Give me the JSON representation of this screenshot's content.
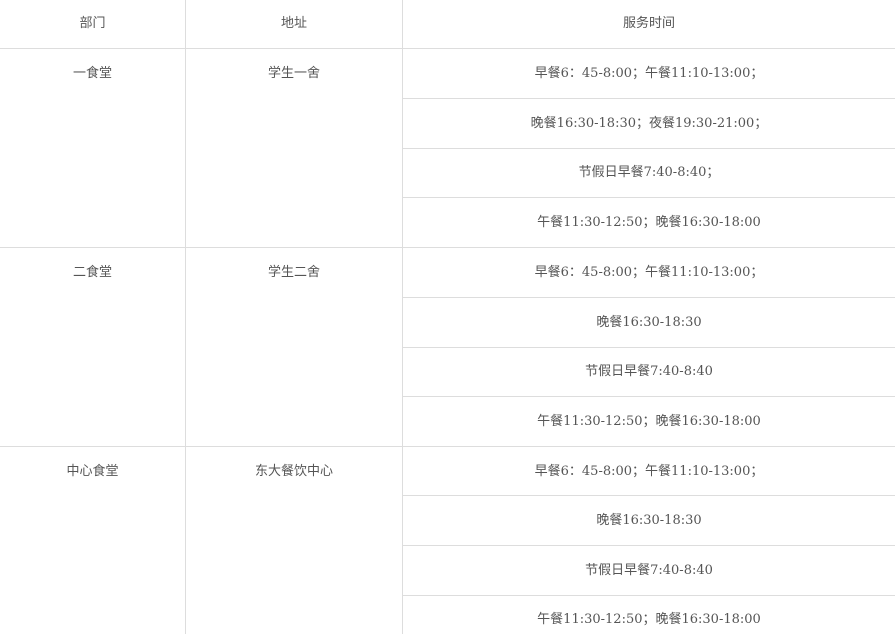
{
  "header": {
    "department": "部门",
    "address": "地址",
    "service_time": "服务时间"
  },
  "rows": [
    {
      "department": "一食堂",
      "address": "学生一舍",
      "times": [
        "早餐6：45-8:00；午餐11:10-13:00；",
        "晚餐16:30-18:30；夜餐19:30-21:00；",
        "节假日早餐7:40-8:40；",
        "午餐11:30-12:50；晚餐16:30-18:00"
      ]
    },
    {
      "department": "二食堂",
      "address": "学生二舍",
      "times": [
        "早餐6：45-8:00；午餐11:10-13:00；",
        "晚餐16:30-18:30",
        "节假日早餐7:40-8:40",
        "午餐11:30-12:50；晚餐16:30-18:00"
      ]
    },
    {
      "department": "中心食堂",
      "address": "东大餐饮中心",
      "times": [
        "早餐6：45-8:00；午餐11:10-13:00；",
        "晚餐16:30-18:30",
        "节假日早餐7:40-8:40",
        "午餐11:30-12:50；晚餐16:30-18:00"
      ]
    }
  ]
}
